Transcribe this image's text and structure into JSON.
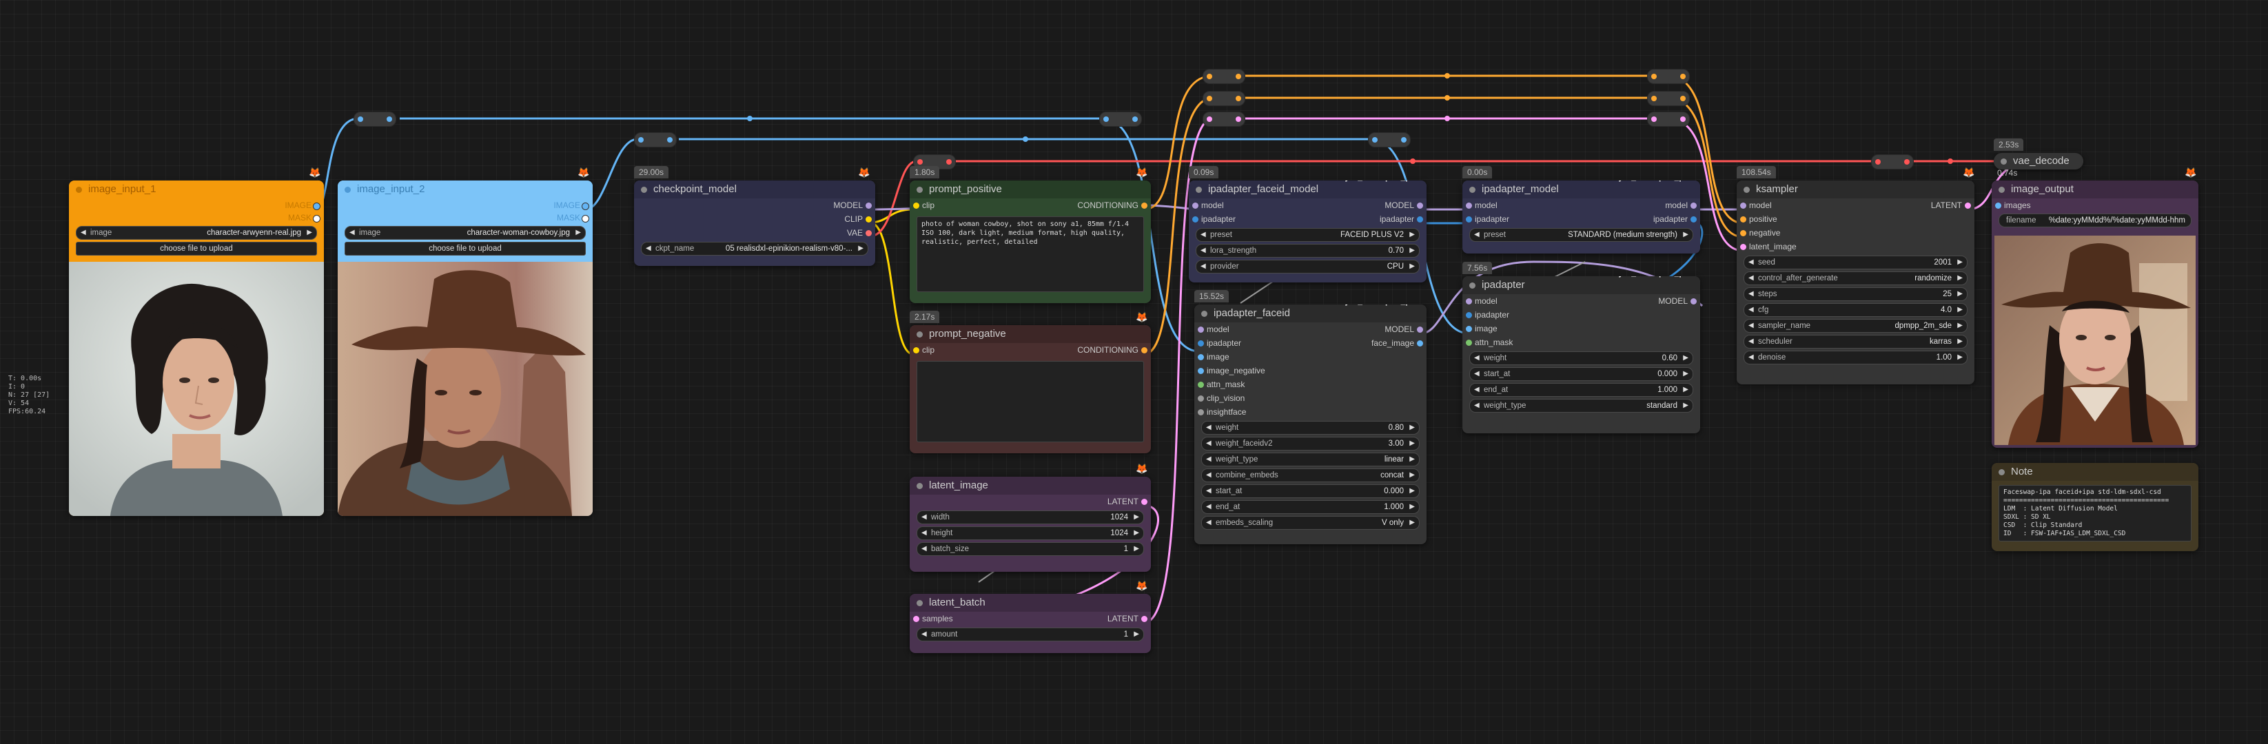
{
  "stats": [
    "T: 0.00s",
    "I: 0",
    "N: 27 [27]",
    "V: 54",
    "FPS:60.24"
  ],
  "colors": {
    "model": "#b39ddb",
    "clip": "#ffd500",
    "vae": "#ff6e6e",
    "conditioning": "#ffa931",
    "latent": "#ff9cf9",
    "image": "#64b5f6",
    "ipadapter": "#3a8fd9",
    "red": "#ff5555",
    "green": "#7ac46b"
  },
  "nodes": {
    "image_input_1": {
      "title": "image_input_1",
      "outputs": [
        "IMAGE",
        "MASK"
      ],
      "widget_label": "image",
      "widget_value": "character-arwyenn-real.jpg",
      "button": "choose file to upload"
    },
    "image_input_2": {
      "title": "image_input_2",
      "outputs": [
        "IMAGE",
        "MASK"
      ],
      "widget_label": "image",
      "widget_value": "character-woman-cowboy.jpg",
      "button": "choose file to upload"
    },
    "checkpoint_model": {
      "time": "29.00s",
      "title": "checkpoint_model",
      "outputs": [
        "MODEL",
        "CLIP",
        "VAE"
      ],
      "widget_label": "ckpt_name",
      "widget_value": "05 realisdxl-epinikion-realism-v80-..."
    },
    "prompt_positive": {
      "time": "1.80s",
      "title": "prompt_positive",
      "input": "clip",
      "output": "CONDITIONING",
      "text": "photo of woman cowboy, shot on sony a1, 85mm f/1.4 ISO 100, dark light, medium format, high quality, realistic, perfect, detailed"
    },
    "prompt_negative": {
      "time": "2.17s",
      "title": "prompt_negative",
      "input": "clip",
      "output": "CONDITIONING",
      "text": ""
    },
    "latent_image": {
      "title": "latent_image",
      "output": "LATENT",
      "widgets": [
        {
          "label": "width",
          "value": "1024"
        },
        {
          "label": "height",
          "value": "1024"
        },
        {
          "label": "batch_size",
          "value": "1"
        }
      ]
    },
    "latent_batch": {
      "title": "latent_batch",
      "input": "samples",
      "output": "LATENT",
      "widgets": [
        {
          "label": "amount",
          "value": "1"
        }
      ]
    },
    "ipadapter_faceid_model": {
      "time": "0.09s",
      "title": "ipadapter_faceid_model",
      "badge": "ComfyUI_IPAdapter_plus",
      "inputs": [
        "model",
        "ipadapter"
      ],
      "outputs": [
        "MODEL",
        "ipadapter"
      ],
      "widgets": [
        {
          "label": "preset",
          "value": "FACEID PLUS V2"
        },
        {
          "label": "lora_strength",
          "value": "0.70"
        },
        {
          "label": "provider",
          "value": "CPU"
        }
      ]
    },
    "ipadapter_faceid": {
      "time": "15.52s",
      "title": "ipadapter_faceid",
      "badge": "ComfyUI_IPAdapter_plus",
      "inputs": [
        "model",
        "ipadapter",
        "image",
        "image_negative",
        "attn_mask",
        "clip_vision",
        "insightface"
      ],
      "outputs": [
        "MODEL",
        "face_image"
      ],
      "widgets": [
        {
          "label": "weight",
          "value": "0.80"
        },
        {
          "label": "weight_faceidv2",
          "value": "3.00"
        },
        {
          "label": "weight_type",
          "value": "linear"
        },
        {
          "label": "combine_embeds",
          "value": "concat"
        },
        {
          "label": "start_at",
          "value": "0.000"
        },
        {
          "label": "end_at",
          "value": "1.000"
        },
        {
          "label": "embeds_scaling",
          "value": "V only"
        }
      ]
    },
    "ipadapter_model": {
      "time": "0.00s",
      "title": "ipadapter_model",
      "badge": "ComfyUI_IPAdapter_plus",
      "inputs": [
        "model",
        "ipadapter"
      ],
      "outputs": [
        "model",
        "ipadapter"
      ],
      "widgets": [
        {
          "label": "preset",
          "value": "STANDARD (medium strength)"
        }
      ]
    },
    "ipadapter": {
      "time": "7.56s",
      "title": "ipadapter",
      "badge": "ComfyUI_IPAdapter_plus",
      "inputs": [
        "model",
        "ipadapter",
        "image",
        "attn_mask"
      ],
      "outputs": [
        "MODEL"
      ],
      "widgets": [
        {
          "label": "weight",
          "value": "0.60"
        },
        {
          "label": "start_at",
          "value": "0.000"
        },
        {
          "label": "end_at",
          "value": "1.000"
        },
        {
          "label": "weight_type",
          "value": "standard"
        }
      ]
    },
    "ksampler": {
      "time": "108.54s",
      "title": "ksampler",
      "inputs": [
        "model",
        "positive",
        "negative",
        "latent_image"
      ],
      "outputs": [
        "LATENT"
      ],
      "widgets": [
        {
          "label": "seed",
          "value": "2001"
        },
        {
          "label": "control_after_generate",
          "value": "randomize"
        },
        {
          "label": "steps",
          "value": "25"
        },
        {
          "label": "cfg",
          "value": "4.0"
        },
        {
          "label": "sampler_name",
          "value": "dpmpp_2m_sde"
        },
        {
          "label": "scheduler",
          "value": "karras"
        },
        {
          "label": "denoise",
          "value": "1.00"
        }
      ]
    },
    "vae_decode": {
      "time": "2.53s",
      "title": "vae_decode",
      "sub_time": "0.74s"
    },
    "image_output": {
      "title": "image_output",
      "input": "images",
      "widget_label": "filename",
      "widget_value": "%date:yyMMdd%/%date:yyMMdd-hhm"
    },
    "note": {
      "title": "Note",
      "text": "Faceswap-ipa faceid+ipa std-ldm-sdxl-csd\n==========================================\nLDM  : Latent Diffusion Model\nSDXL : SD XL\nCSD  : Clip Standard\nID   : FSW-IAF+IAS_LDM_SDXL_CSD"
    }
  }
}
